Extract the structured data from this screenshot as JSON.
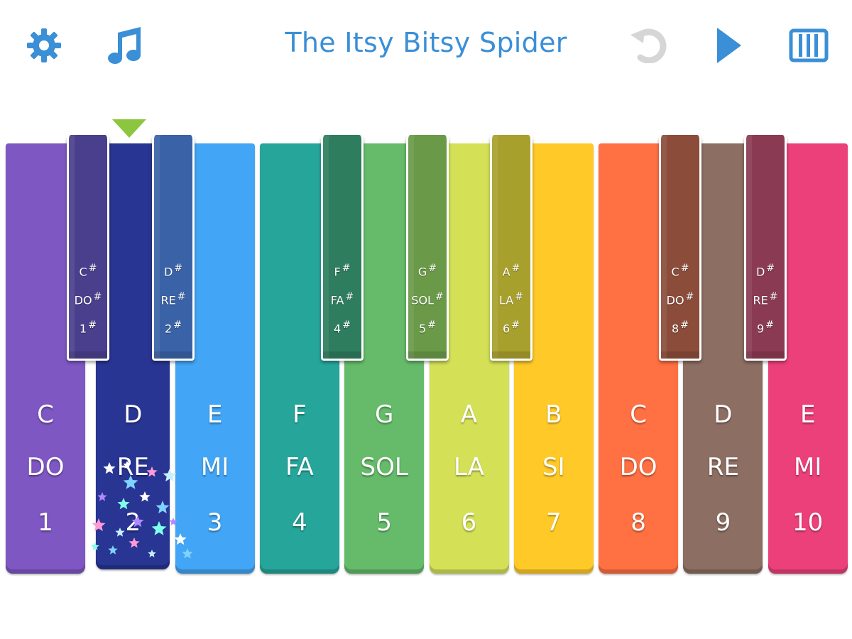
{
  "header": {
    "title": "The Itsy Bitsy Spider",
    "icons": [
      "gear-icon",
      "music-note-icon",
      "undo-icon",
      "play-icon",
      "piano-keys-icon"
    ],
    "accent_color": "#3a8fd6",
    "disabled_color": "#d6d6d6"
  },
  "piano": {
    "current_key_marker_color": "#8cc63f",
    "active_key": "D RE 2",
    "white_keys": [
      {
        "note": "C",
        "solfege": "DO",
        "number": "1",
        "color": "#7e57c2"
      },
      {
        "note": "D",
        "solfege": "RE",
        "number": "2",
        "color": "#283593"
      },
      {
        "note": "E",
        "solfege": "MI",
        "number": "3",
        "color": "#42a5f5"
      },
      {
        "note": "F",
        "solfege": "FA",
        "number": "4",
        "color": "#26a69a"
      },
      {
        "note": "G",
        "solfege": "SOL",
        "number": "5",
        "color": "#66bb6a"
      },
      {
        "note": "A",
        "solfege": "LA",
        "number": "6",
        "color": "#d4e157"
      },
      {
        "note": "B",
        "solfege": "SI",
        "number": "7",
        "color": "#ffca28"
      },
      {
        "note": "C",
        "solfege": "DO",
        "number": "8",
        "color": "#ff7043"
      },
      {
        "note": "D",
        "solfege": "RE",
        "number": "9",
        "color": "#8d6e63"
      },
      {
        "note": "E",
        "solfege": "MI",
        "number": "10",
        "color": "#ec407a"
      }
    ],
    "black_keys": [
      {
        "note": "C",
        "solfege": "DO",
        "number": "1",
        "sharp": "#",
        "color": "#4a3f8c"
      },
      {
        "note": "D",
        "solfege": "RE",
        "number": "2",
        "sharp": "#",
        "color": "#3a62a6"
      },
      {
        "note": "F",
        "solfege": "FA",
        "number": "4",
        "sharp": "#",
        "color": "#2e7d5e"
      },
      {
        "note": "G",
        "solfege": "SOL",
        "number": "5",
        "sharp": "#",
        "color": "#6a9a48"
      },
      {
        "note": "A",
        "solfege": "LA",
        "number": "6",
        "sharp": "#",
        "color": "#a8a02c"
      },
      {
        "note": "C",
        "solfege": "DO",
        "number": "8",
        "sharp": "#",
        "color": "#8b4c3a"
      },
      {
        "note": "D",
        "solfege": "RE",
        "number": "9",
        "sharp": "#",
        "color": "#8a3a52"
      }
    ]
  }
}
